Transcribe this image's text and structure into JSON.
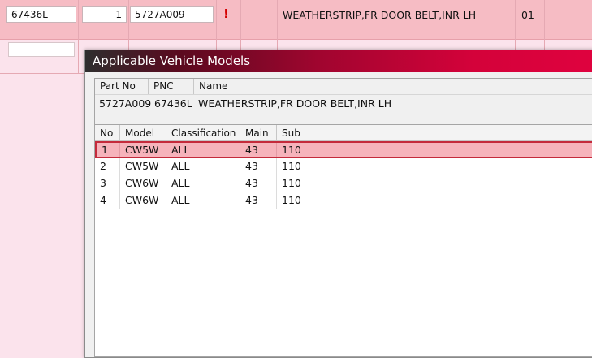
{
  "background_row": {
    "pnc": "67436L",
    "qty": "1",
    "part_no": "5727A009",
    "alert": "!",
    "name": "WEATHERSTRIP,FR DOOR BELT,INR LH",
    "code": "01"
  },
  "dialog": {
    "title": "Applicable Vehicle Models",
    "info_headers": {
      "part_no": "Part No",
      "pnc": "PNC",
      "name": "Name"
    },
    "info_values": {
      "part_no": "5727A009",
      "pnc": "67436L",
      "name": "WEATHERSTRIP,FR DOOR BELT,INR LH"
    },
    "table": {
      "headers": [
        "No",
        "Model",
        "Classification",
        "Main",
        "Sub"
      ],
      "rows": [
        [
          "1",
          "CW5W",
          "ALL",
          "43",
          "110"
        ],
        [
          "2",
          "CW5W",
          "ALL",
          "43",
          "110"
        ],
        [
          "3",
          "CW6W",
          "ALL",
          "43",
          "110"
        ],
        [
          "4",
          "CW6W",
          "ALL",
          "43",
          "110"
        ]
      ],
      "selected_row": 1
    }
  },
  "colors": {
    "accent": "#d4023a",
    "selected_row_bg": "#f6b3bb",
    "alert": "#d40000"
  }
}
